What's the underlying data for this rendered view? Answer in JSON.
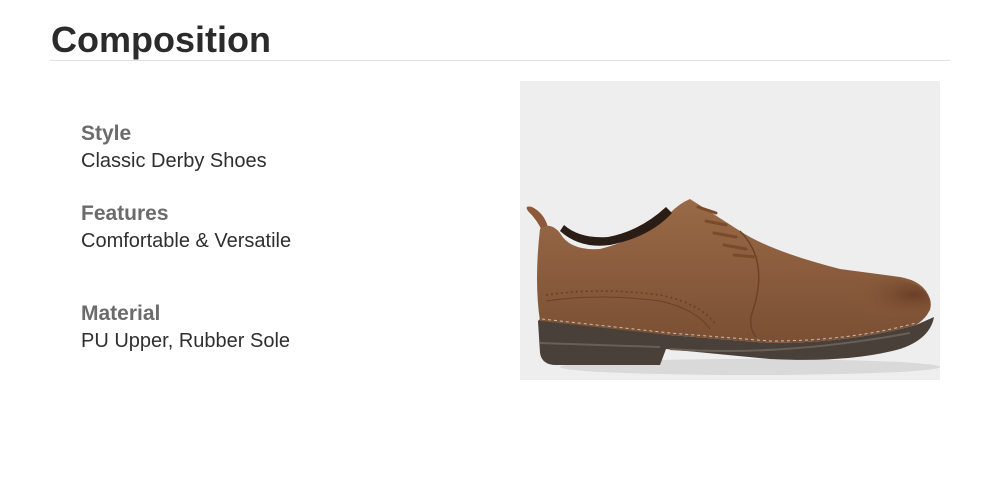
{
  "title": "Composition",
  "specs": [
    {
      "label": "Style",
      "value": "Classic Derby Shoes"
    },
    {
      "label": "Features",
      "value": "Comfortable & Versatile"
    },
    {
      "label": "Material",
      "value": "PU Upper, Rubber Sole"
    }
  ],
  "image": {
    "subject": "brown leather derby shoe",
    "colors": {
      "background": "#eeeeee",
      "upper": "#8a5a3a",
      "sole": "#4a403a"
    }
  }
}
